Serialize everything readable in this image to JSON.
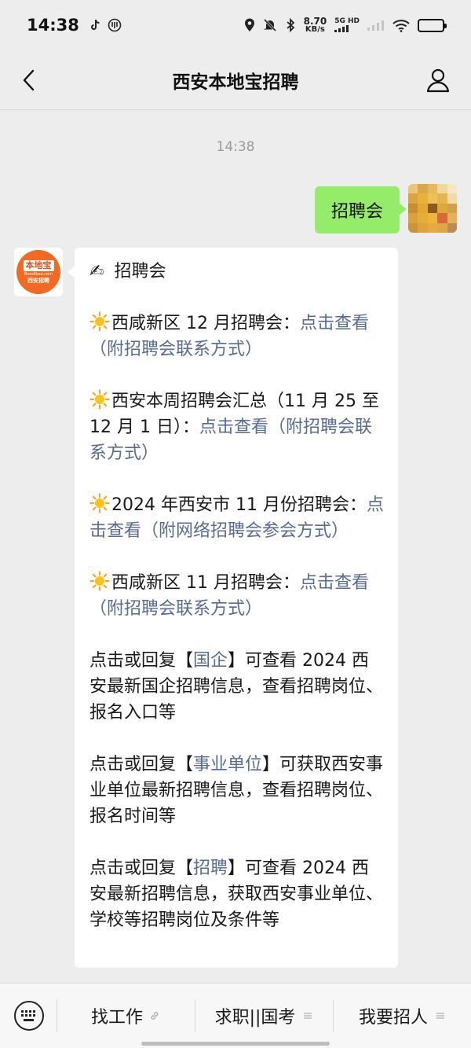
{
  "status_bar": {
    "time": "14:38",
    "net_speed_value": "8.70",
    "net_speed_unit": "KB/s",
    "network_label": "5G HD"
  },
  "nav": {
    "title": "西安本地宝招聘"
  },
  "chat": {
    "timestamp": "14:38",
    "outgoing_message": "招聘会",
    "bot_logo": {
      "line1": "本地宝",
      "line2": "Bendibao.com",
      "line3": "西安招聘"
    },
    "incoming": {
      "header_emoji": "✍",
      "header_text": "招聘会",
      "items": [
        {
          "text": "西咸新区 12 月招聘会：",
          "link": "点击查看（附招聘会联系方式）"
        },
        {
          "text": "西安本周招聘会汇总（11 月 25 至 12 月 1 日）：",
          "link": "点击查看（附招聘会联系方式）"
        },
        {
          "text": "2024 年西安市 11 月份招聘会：",
          "link": "点击查看（附网络招聘会参会方式）"
        },
        {
          "text": "西咸新区 11 月招聘会：",
          "link": "点击查看（附招聘会联系方式）"
        }
      ],
      "replies": [
        {
          "pre": "点击或回复【",
          "keyword": "国企",
          "post": "】可查看 2024 西安最新国企招聘信息，查看招聘岗位、报名入口等"
        },
        {
          "pre": "点击或回复【",
          "keyword": "事业单位",
          "post": "】可获取西安事业单位最新招聘信息，查看招聘岗位、报名时间等"
        },
        {
          "pre": "点击或回复【",
          "keyword": "招聘",
          "post": "】可查看 2024 西安最新招聘信息，获取西安事业单位、学校等招聘岗位及条件等"
        }
      ]
    }
  },
  "bottom_menu": {
    "items": [
      {
        "label": "找工作",
        "suffix_icon": "link-icon"
      },
      {
        "label": "求职||国考",
        "suffix_icon": "menu-lines-icon"
      },
      {
        "label": "我要招人",
        "suffix_icon": "menu-lines-icon"
      }
    ]
  },
  "colors": {
    "background": "#ededed",
    "outgoing_bubble": "#95ec69",
    "link": "#576b95",
    "brand_orange": "#f26a21"
  }
}
